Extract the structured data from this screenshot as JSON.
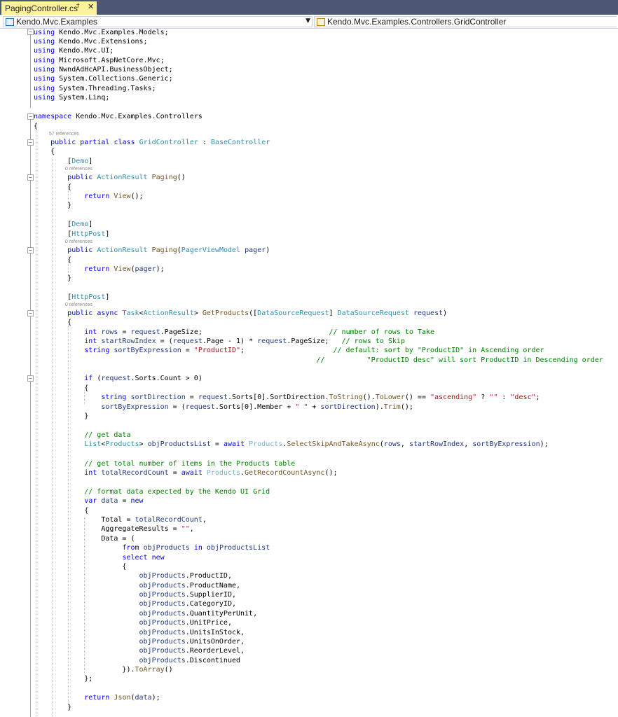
{
  "tab": {
    "title": "PagingController.cs",
    "pin": "†",
    "close": "✕"
  },
  "nav": {
    "project": "Kendo.Mvc.Examples",
    "type": "Kendo.Mvc.Examples.Controllers.GridController"
  },
  "codelens": {
    "class_refs": "57 references",
    "paging_refs": "0 references",
    "paging_post_refs": "0 references",
    "getproducts_refs": "0 references"
  },
  "code": [
    "using Kendo.Mvc.Examples.Models;",
    "using Kendo.Mvc.Extensions;",
    "using Kendo.Mvc.UI;",
    "using Microsoft.AspNetCore.Mvc;",
    "using NwndAdHcAPI.BusinessObject;",
    "using System.Collections.Generic;",
    "using System.Threading.Tasks;",
    "using System.Linq;"
  ]
}
